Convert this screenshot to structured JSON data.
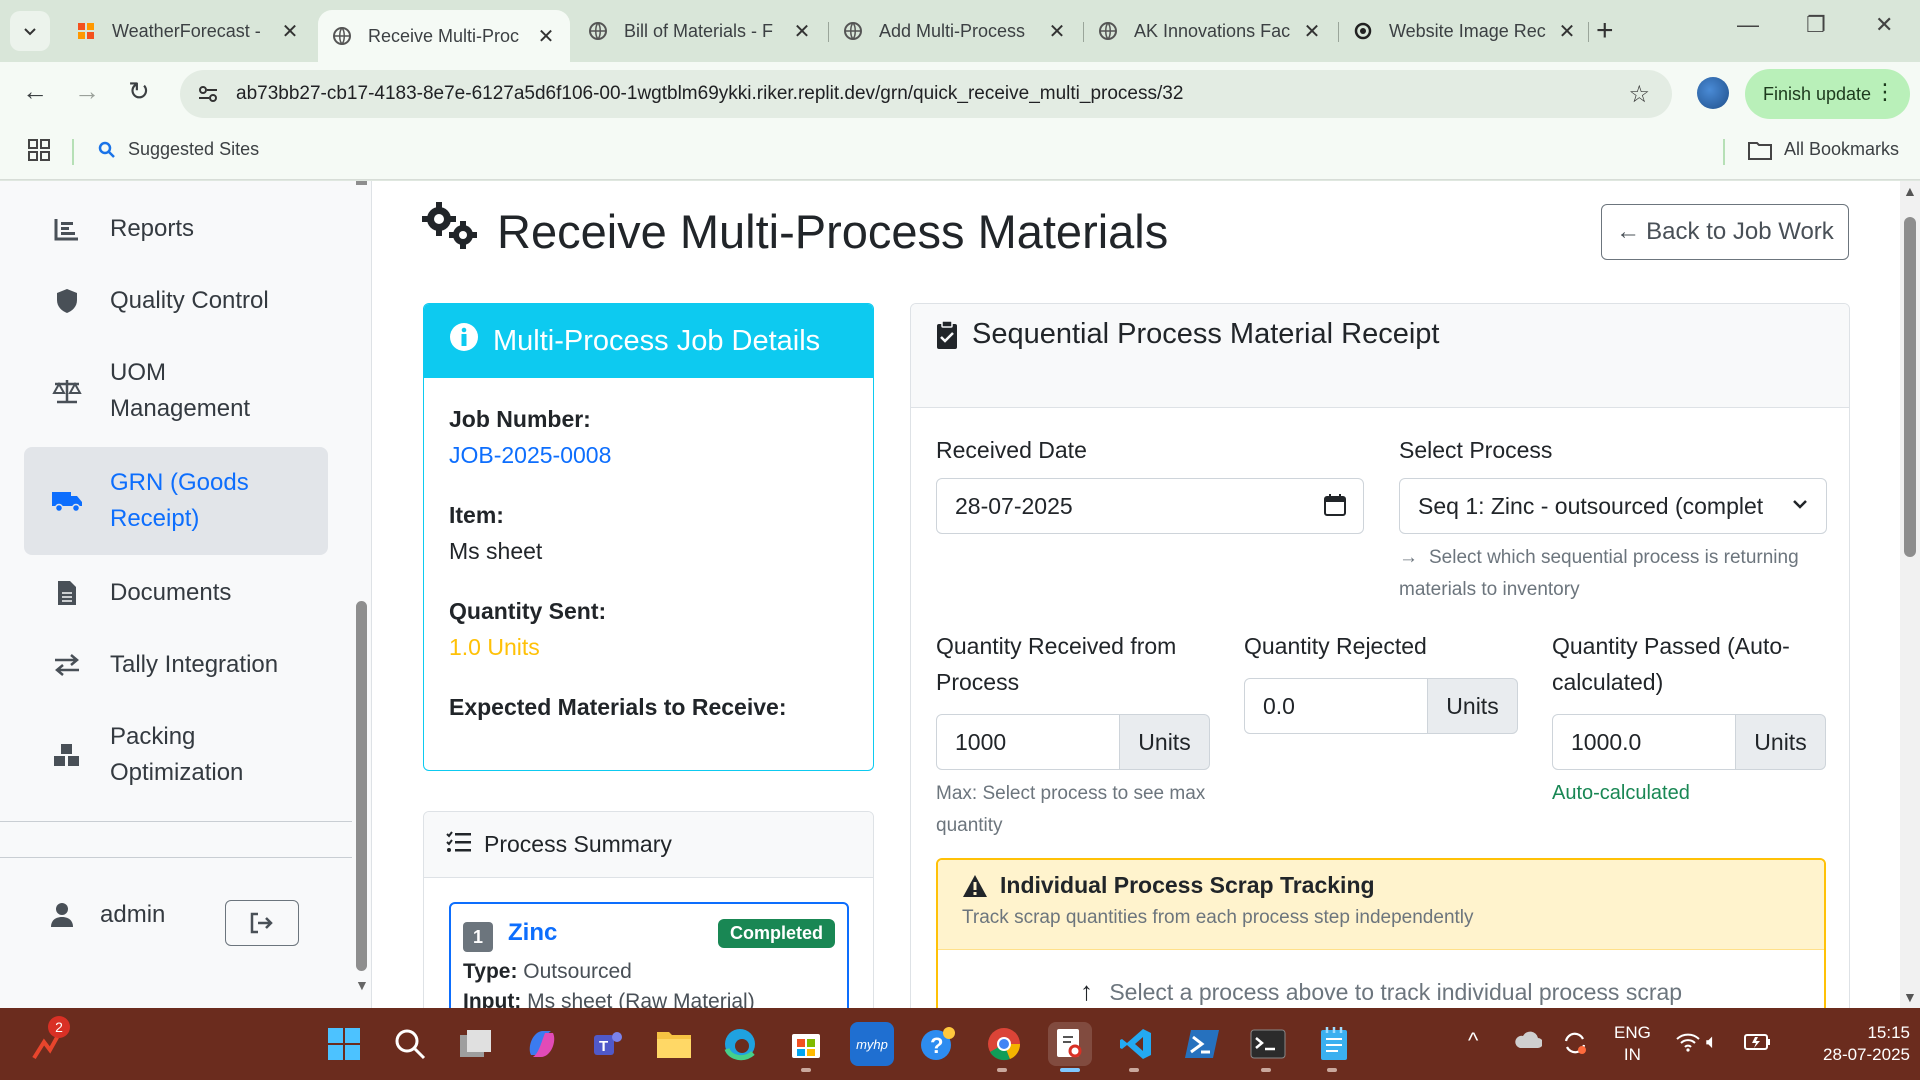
{
  "browser": {
    "tabs": [
      {
        "title": "WeatherForecast -",
        "active": false
      },
      {
        "title": "Receive Multi-Proc",
        "active": true
      },
      {
        "title": "Bill of Materials - F",
        "active": false
      },
      {
        "title": "Add Multi-Process",
        "active": false
      },
      {
        "title": "AK Innovations Fac",
        "active": false
      },
      {
        "title": "Website Image Rec",
        "active": false
      }
    ],
    "url": "ab73bb27-cb17-4183-8e7e-6127a5d6f106-00-1wgtblm69ykki.riker.replit.dev/grn/quick_receive_multi_process/32",
    "finish_update_label": "Finish update",
    "bookmarks": {
      "suggested": "Suggested Sites",
      "all": "All Bookmarks"
    }
  },
  "sidebar": {
    "items": [
      {
        "label": "Reports",
        "icon": "chart-bar-icon"
      },
      {
        "label": "Quality Control",
        "icon": "shield-icon"
      },
      {
        "label": "UOM\nManagement",
        "icon": "balance-scale-icon"
      },
      {
        "label": "GRN (Goods\nReceipt)",
        "icon": "truck-icon",
        "active": true
      },
      {
        "label": "Documents",
        "icon": "file-icon"
      },
      {
        "label": "Tally Integration",
        "icon": "exchange-icon"
      },
      {
        "label": "Packing\nOptimization",
        "icon": "cubes-icon"
      }
    ],
    "user": "admin"
  },
  "page": {
    "title": "Receive Multi-Process Materials",
    "back_button": "Back to Job Work"
  },
  "job_details": {
    "header": "Multi-Process Job Details",
    "job_number_label": "Job Number:",
    "job_number": "JOB-2025-0008",
    "item_label": "Item:",
    "item": "Ms sheet",
    "quantity_sent_label": "Quantity Sent:",
    "quantity_sent": "1.0 Units",
    "expected_label": "Expected Materials to Receive:"
  },
  "process_summary": {
    "header": "Process Summary",
    "process": {
      "seq": "1",
      "name": "Zinc",
      "status": "Completed",
      "type_label": "Type:",
      "type": "Outsourced",
      "input_label": "Input:",
      "input": "Ms sheet (Raw Material)"
    }
  },
  "receipt": {
    "header": "Sequential Process Material Receipt",
    "received_date_label": "Received Date",
    "received_date": "28-07-2025",
    "select_process_label": "Select Process",
    "select_process_value": "Seq 1: Zinc - outsourced (complet",
    "select_process_help": "Select which sequential process is returning materials to inventory",
    "qty_received_label": "Quantity Received from Process",
    "qty_received": "1000",
    "qty_received_help": "Max: Select process to see max quantity",
    "qty_rejected_label": "Quantity Rejected",
    "qty_rejected": "0.0",
    "qty_passed_label": "Quantity Passed (Auto-calculated)",
    "qty_passed": "1000.0",
    "qty_passed_help": "Auto-calculated",
    "unit": "Units"
  },
  "scrap": {
    "title": "Individual Process Scrap Tracking",
    "subtitle": "Track scrap quantities from each process step independently",
    "body": "Select a process above to track individual process scrap"
  },
  "taskbar": {
    "notification_count": "2",
    "lang_top": "ENG",
    "lang_bottom": "IN",
    "time": "15:15",
    "date": "28-07-2025"
  },
  "colors": {
    "primary": "#0d6efd",
    "info": "#0dcaf0",
    "warning": "#ffc107",
    "success": "#198754",
    "taskbar": "#6b2c1e"
  }
}
